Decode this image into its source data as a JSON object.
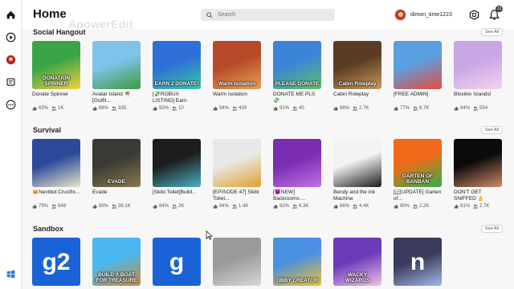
{
  "topbar": {
    "title": "Home",
    "watermark": "ApowerEdit",
    "search_placeholder": "Search",
    "username": "dimon_time1223",
    "notifications_count": "13"
  },
  "rail": {
    "icons": [
      "home-icon",
      "play-icon",
      "avatar-icon",
      "chat-icon",
      "more-icon",
      "windows-icon"
    ]
  },
  "sections": [
    {
      "title": "Social Hangout",
      "see_all": "See All",
      "games": [
        {
          "title": "Donate Spinner",
          "thumb_text": "DONATION SPINNER",
          "rating": "63%",
          "players": "1K",
          "c1": "#3aa447",
          "c2": "#f0d040"
        },
        {
          "title": "Avatar Island 🌴[Outfit...",
          "thumb_text": "",
          "rating": "86%",
          "players": "335",
          "c1": "#7fc3ea",
          "c2": "#3c9a3c"
        },
        {
          "title": "[💸ROBUX LISTING] Earn",
          "thumb_text": "EARN 2 DONATE!",
          "rating": "93%",
          "players": "10",
          "c1": "#2f6fd8",
          "c2": "#38c7a4"
        },
        {
          "title": "Warm Isolation",
          "thumb_text": "Warm Isolation",
          "rating": "94%",
          "players": "439",
          "c1": "#b64a2a",
          "c2": "#e5a055"
        },
        {
          "title": "DONATE ME PLS 💸",
          "thumb_text": "PLEASE DONATE",
          "rating": "91%",
          "players": "40",
          "c1": "#3c85d6",
          "c2": "#5cc066"
        },
        {
          "title": "Cabin Roleplay",
          "thumb_text": "Cabin Roleplay",
          "rating": "88%",
          "players": "2.7K",
          "c1": "#5a3c24",
          "c2": "#c99a5a"
        },
        {
          "title": "[FREE ADMIN]",
          "thumb_text": "",
          "rating": "77%",
          "players": "6.7K",
          "c1": "#5aa0e0",
          "c2": "#e84a3a"
        },
        {
          "title": "Bloxikin Islands!",
          "thumb_text": "",
          "rating": "94%",
          "players": "554",
          "c1": "#c9a6e6",
          "c2": "#f4d2ec"
        }
      ]
    },
    {
      "title": "Survival",
      "see_all": "See All",
      "games": [
        {
          "title": "🐱Nextbot Crucifix...",
          "thumb_text": "",
          "rating": "79%",
          "players": "648",
          "c1": "#2d4a9a",
          "c2": "#e9e4c8"
        },
        {
          "title": "Evade",
          "thumb_text": "EVADE",
          "rating": "95%",
          "players": "38.1K",
          "c1": "#3a3a36",
          "c2": "#8a7a4a"
        },
        {
          "title": "[Skibi Toilet]Build...",
          "thumb_text": "",
          "rating": "84%",
          "players": "2K",
          "c1": "#1d1d1d",
          "c2": "#4ab0c4"
        },
        {
          "title": "[EPISODE 47] Skibi Toilet...",
          "thumb_text": "",
          "rating": "94%",
          "players": "1.4K",
          "c1": "#e8e8e8",
          "c2": "#e0a030"
        },
        {
          "title": "[😈NEW] Backrooms-...",
          "thumb_text": "",
          "rating": "82%",
          "players": "6.3K",
          "c1": "#7a2db0",
          "c2": "#c070e8"
        },
        {
          "title": "Bendy and the ink Machine",
          "thumb_text": "",
          "rating": "66%",
          "players": "4.4K",
          "c1": "#f3f3f3",
          "c2": "#1a1a1a"
        },
        {
          "title": "[🔄UPDATE] Garten of...",
          "thumb_text": "GARTEN OF BANBAN",
          "rating": "90%",
          "players": "2.2K",
          "c1": "#f06a1a",
          "c2": "#30b04a"
        },
        {
          "title": "DON'T GET SNIFFED 👃",
          "thumb_text": "",
          "rating": "81%",
          "players": "2.7K",
          "c1": "#0b0b0b",
          "c2": "#d08a6a"
        }
      ]
    },
    {
      "title": "Sandbox",
      "see_all": "See All",
      "games": [
        {
          "title": "",
          "thumb_text": "g2",
          "rating": "",
          "players": "",
          "c1": "#1a63d6",
          "c2": "#1a63d6"
        },
        {
          "title": "",
          "thumb_text": "BUILD A BOAT FOR TREASURE",
          "rating": "",
          "players": "",
          "c1": "#4ab8f0",
          "c2": "#c78a3a"
        },
        {
          "title": "",
          "thumb_text": "g",
          "rating": "",
          "players": "",
          "c1": "#1a63d6",
          "c2": "#1a63d6"
        },
        {
          "title": "",
          "thumb_text": "",
          "rating": "",
          "players": "",
          "c1": "#9a9a9a",
          "c2": "#d8d8d8"
        },
        {
          "title": "",
          "thumb_text": "OBBY CREATOR",
          "rating": "",
          "players": "",
          "c1": "#4a90e0",
          "c2": "#f0c030"
        },
        {
          "title": "",
          "thumb_text": "WACKY WIZARDS",
          "rating": "",
          "players": "",
          "c1": "#6a3ab8",
          "c2": "#f3c1e6"
        },
        {
          "title": "",
          "thumb_text": "n",
          "rating": "",
          "players": "",
          "c1": "#3a3a5a",
          "c2": "#a0b8e8"
        }
      ]
    }
  ],
  "colors": {
    "accent": "#1a63d6",
    "text": "#1b1b1b",
    "muted": "#555555",
    "background": "#f7f7f8"
  }
}
